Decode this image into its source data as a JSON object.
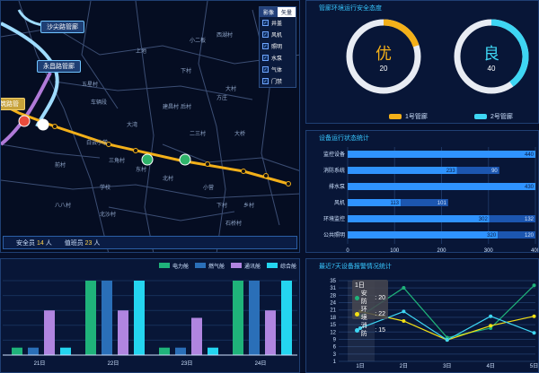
{
  "map": {
    "tags": [
      "沙尖路管廊",
      "永昌路管廊",
      "筑路管"
    ],
    "legend_tabs": [
      "影像",
      "矢量"
    ],
    "legend_items": [
      "井盖",
      "风机",
      "照明",
      "水泵",
      "气体",
      "门禁"
    ],
    "places": [
      "上地",
      "小二板",
      "西湖村",
      "大村",
      "建昌村",
      "车辆段",
      "二三村",
      "东村",
      "三角村",
      "北村",
      "下村",
      "乡村",
      "北沙村",
      "八八村",
      "五星村",
      "下村",
      "大桥",
      "方庄",
      "大湾",
      "小营",
      "石桥村",
      "学校",
      "前村",
      "后村",
      "白云小学"
    ],
    "stats": [
      {
        "label": "安全员",
        "value": "14",
        "unit": "人"
      },
      {
        "label": "值班员",
        "value": "23",
        "unit": "人"
      }
    ],
    "colors": {
      "route": "#f3b019",
      "road": "#b9c6dd",
      "tag_border": "#6fc3ff"
    }
  },
  "safety": {
    "title": "管廊环境运行安全态度",
    "rings": [
      {
        "grade": "优",
        "value": "20",
        "color": "#f3b019",
        "fraction": 0.2
      },
      {
        "grade": "良",
        "value": "40",
        "color": "#3ed6f3",
        "fraction": 0.4
      }
    ],
    "legend": [
      "1号管廊",
      "2号管廊"
    ]
  },
  "equip": {
    "title": "设备运行状态统计",
    "chart_data": {
      "type": "bar",
      "orientation": "horizontal",
      "categories": [
        "监控设备",
        "消防系统",
        "排水泵",
        "风机",
        "环境监控",
        "公共照明"
      ],
      "series": [
        {
          "values": [
            440,
            233,
            430,
            113,
            302,
            320
          ]
        },
        {
          "values": [
            0,
            90,
            0,
            101,
            132,
            120
          ]
        }
      ],
      "xlim": [
        0,
        400
      ],
      "ticks": [
        "0",
        "100",
        "200",
        "300",
        "400"
      ],
      "colors": [
        "#2f93ff",
        "#1c56b0"
      ]
    }
  },
  "daily": {
    "legend": [
      "电力舱",
      "燃气舱",
      "通讯舱",
      "综合舱"
    ],
    "colors": [
      "#1fb37a",
      "#2a6fb8",
      "#b085e0",
      "#24d5f0"
    ],
    "chart_data": {
      "type": "bar",
      "categories": [
        "21日",
        "22日",
        "23日",
        "24日"
      ],
      "series": [
        {
          "name": "电力舱",
          "values": [
            10,
            100,
            10,
            100
          ]
        },
        {
          "name": "燃气舱",
          "values": [
            10,
            100,
            10,
            100
          ]
        },
        {
          "name": "通讯舱",
          "values": [
            60,
            60,
            50,
            60
          ]
        },
        {
          "name": "综合舱",
          "values": [
            10,
            100,
            10,
            100
          ]
        }
      ],
      "ylim": [
        0,
        100
      ]
    }
  },
  "week": {
    "title": "最近7天设备报警情况统计",
    "chart_data": {
      "type": "line",
      "categories": [
        "1日",
        "2日",
        "3日",
        "4日",
        "5日"
      ],
      "series": [
        {
          "name": "安防",
          "values": [
            20,
            32,
            11,
            15,
            33
          ],
          "color": "#1fb37a"
        },
        {
          "name": "环境",
          "values": [
            22,
            18,
            10,
            16,
            20
          ],
          "color": "#f3e014"
        },
        {
          "name": "消防",
          "values": [
            15,
            22,
            10,
            20,
            13
          ],
          "color": "#3ed6f3"
        }
      ],
      "yticks": [
        "1",
        "3",
        "6",
        "9",
        "12",
        "15",
        "18",
        "21",
        "24",
        "28",
        "31",
        "35"
      ],
      "ylim": [
        1,
        35
      ]
    },
    "tooltip": {
      "title": "1日",
      "rows": [
        {
          "label": "安防",
          "value": "20"
        },
        {
          "label": "环境",
          "value": "22"
        },
        {
          "label": "消防",
          "value": "15"
        }
      ]
    }
  }
}
